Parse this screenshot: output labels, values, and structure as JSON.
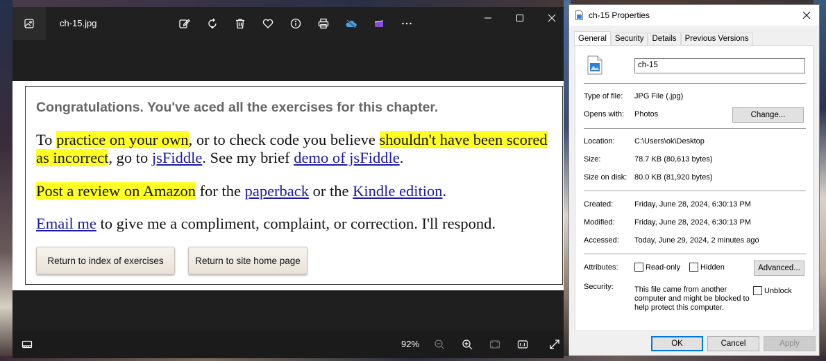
{
  "photos": {
    "filename": "ch-15.jpg",
    "toolbar": {
      "icons": [
        "edit-icon",
        "rotate-icon",
        "delete-icon",
        "favorite-icon",
        "info-icon",
        "print-icon",
        "onedrive-icon",
        "clipchamp-icon",
        "more-icon"
      ]
    },
    "image": {
      "heading": "Congratulations. You've aced all the exercises for this chapter.",
      "p1": {
        "t1": "To ",
        "h1": "practice on your own",
        "t2": ", or to check code you believe ",
        "h2": "shouldn't have been scored as incorrect",
        "t3": ", go to ",
        "l1": "jsFiddle",
        "t4": ". See my brief ",
        "l2": "demo of jsFiddle",
        "t5": "."
      },
      "p2": {
        "h1": "Post a review on Amazon",
        "t1": " for the ",
        "l1": "paperback",
        "t2": " or the ",
        "l2": "Kindle edition",
        "t3": "."
      },
      "p3": {
        "l1": "Email me",
        "t1": " to give me a compliment, complaint, or correction. I'll respond."
      },
      "buttons": {
        "index": "Return to index of exercises",
        "home": "Return to site home page"
      }
    },
    "zoom": "92%"
  },
  "properties": {
    "title": "ch-15 Properties",
    "tabs": [
      "General",
      "Security",
      "Details",
      "Previous Versions"
    ],
    "active_tab": "General",
    "name_value": "ch-15",
    "type_label": "Type of file:",
    "type_value": "JPG File (.jpg)",
    "opens_label": "Opens with:",
    "opens_value": "Photos",
    "change_button": "Change...",
    "location_label": "Location:",
    "location_value": "C:\\Users\\ok\\Desktop",
    "size_label": "Size:",
    "size_value": "78.7 KB (80,613 bytes)",
    "size_disk_label": "Size on disk:",
    "size_disk_value": "80.0 KB (81,920 bytes)",
    "created_label": "Created:",
    "created_value": "Friday, June 28, 2024, 6:30:13 PM",
    "modified_label": "Modified:",
    "modified_value": "Friday, June 28, 2024, 6:30:13 PM",
    "accessed_label": "Accessed:",
    "accessed_value": "Today, June 29, 2024, 2 minutes ago",
    "attributes_label": "Attributes:",
    "readonly_label": "Read-only",
    "readonly_checked": false,
    "hidden_label": "Hidden",
    "hidden_checked": false,
    "advanced_button": "Advanced...",
    "security_label": "Security:",
    "security_text": "This file came from another computer and might be blocked to help protect this computer.",
    "unblock_label": "Unblock",
    "unblock_checked": false,
    "ok_button": "OK",
    "cancel_button": "Cancel",
    "apply_button": "Apply"
  }
}
